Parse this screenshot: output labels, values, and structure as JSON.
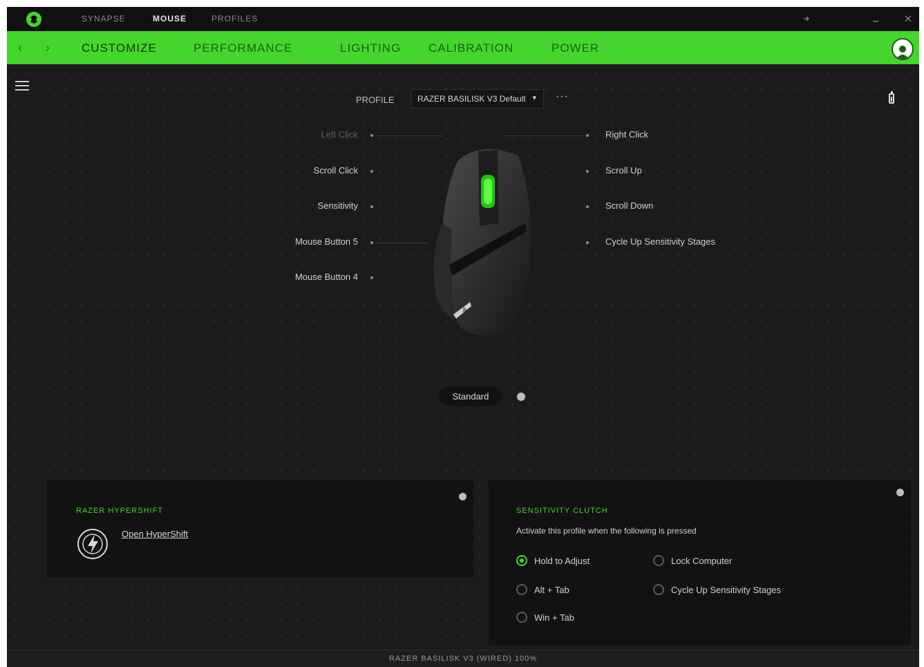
{
  "title_bar": {
    "tabs": [
      {
        "label": "SYNAPSE",
        "active": false
      },
      {
        "label": "MOUSE",
        "active": true
      },
      {
        "label": "PROFILES",
        "active": false
      }
    ],
    "window_controls": [
      "minimize-to-tray-icon",
      "minimize-icon",
      "close-icon"
    ]
  },
  "nav": {
    "tabs": [
      {
        "label": "CUSTOMIZE",
        "active": true
      },
      {
        "label": "PERFORMANCE",
        "active": false
      },
      {
        "label": "LIGHTING",
        "active": false
      },
      {
        "label": "CALIBRATION",
        "active": false
      },
      {
        "label": "POWER",
        "active": false
      }
    ],
    "accent_color": "#44d62c"
  },
  "profile": {
    "label": "PROFILE",
    "selected": "RAZER BASILISK V3 Default",
    "more": "···"
  },
  "buttons_left": [
    {
      "label": "Left Click",
      "dim": true
    },
    {
      "label": "Scroll Click",
      "dim": false
    },
    {
      "label": "Sensitivity",
      "dim": false
    },
    {
      "label": "Mouse Button 5",
      "dim": false
    },
    {
      "label": "Mouse Button 4",
      "dim": false
    }
  ],
  "buttons_right": [
    {
      "label": "Right Click"
    },
    {
      "label": "Scroll Up"
    },
    {
      "label": "Scroll Down"
    },
    {
      "label": "Cycle Up Sensitivity Stages"
    }
  ],
  "mode_toggle": {
    "label": "Standard"
  },
  "hypershift_panel": {
    "title": "RAZER HYPERSHIFT",
    "link": "Open HyperShift"
  },
  "sensitivity_panel": {
    "title": "SENSITIVITY CLUTCH",
    "subtitle": "Activate this profile when the following is pressed",
    "options": [
      {
        "label": "Hold to Adjust",
        "checked": true
      },
      {
        "label": "Lock Computer",
        "checked": false
      },
      {
        "label": "Alt + Tab",
        "checked": false
      },
      {
        "label": "Cycle Up Sensitivity Stages",
        "checked": false
      },
      {
        "label": "Win + Tab",
        "checked": false
      }
    ]
  },
  "status_bar": {
    "text": "RAZER BASILISK V3 (WIRED) 100%"
  }
}
